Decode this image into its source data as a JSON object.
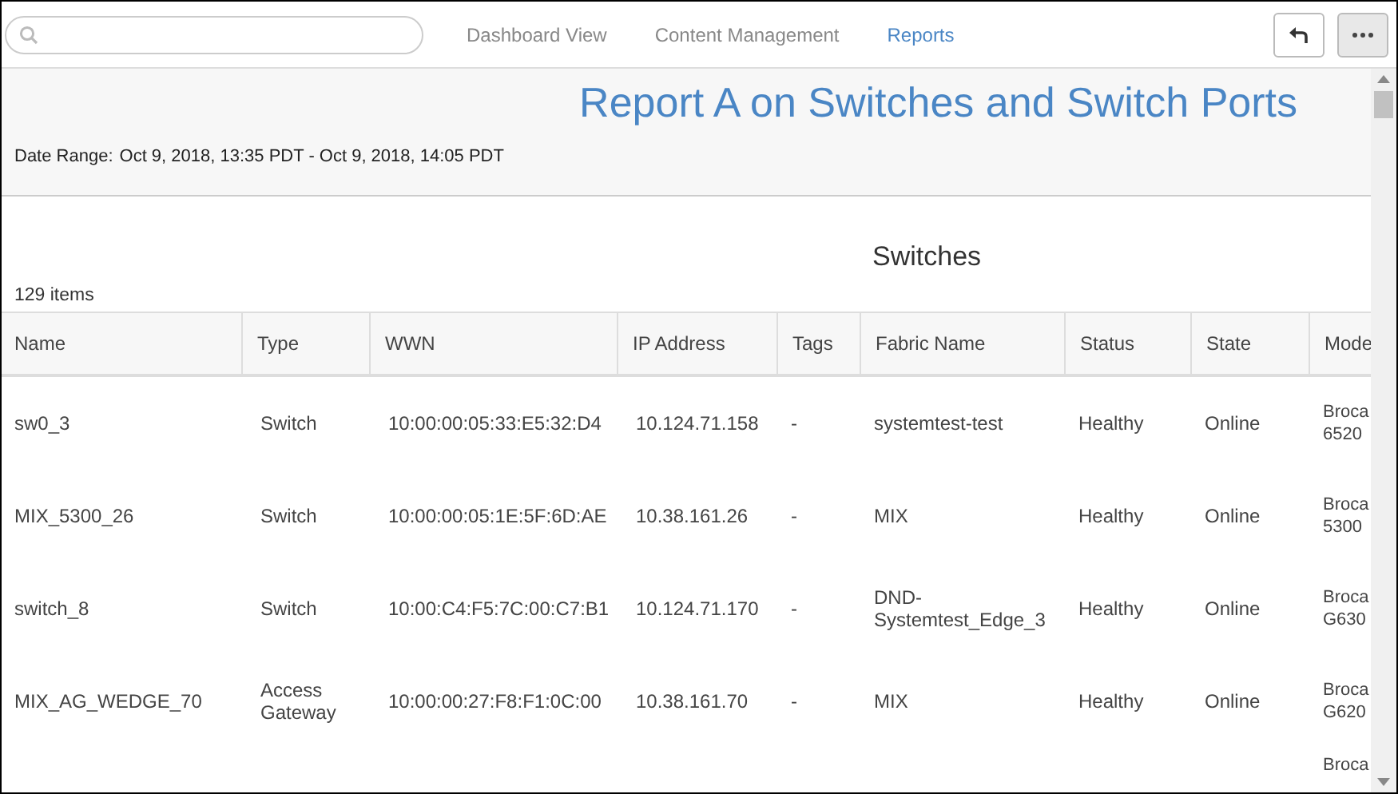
{
  "nav": [
    {
      "label": "Dashboard View",
      "selected": false
    },
    {
      "label": "Content Management",
      "selected": false
    },
    {
      "label": "Reports",
      "selected": true
    }
  ],
  "report": {
    "title": "Report A on Switches and Switch Ports",
    "date_range_label": "Date Range:",
    "date_range": "Oct 9, 2018, 13:35 PDT - Oct 9, 2018, 14:05 PDT"
  },
  "table": {
    "title": "Switches",
    "count": "129 items",
    "columns": [
      "Name",
      "Type",
      "WWN",
      "IP Address",
      "Tags",
      "Fabric Name",
      "Status",
      "State",
      "Mode"
    ],
    "rows": [
      {
        "cells": [
          [
            "sw0_3"
          ],
          [
            "Switch"
          ],
          [
            "10:00:00:05:33:E5:32:D4"
          ],
          [
            "10.124.71.158"
          ],
          [
            "-"
          ],
          [
            "systemtest-test"
          ],
          [
            "Healthy"
          ],
          [
            "Online"
          ],
          [
            "Broca",
            "6520"
          ]
        ]
      },
      {
        "cells": [
          [
            "MIX_5300_26"
          ],
          [
            "Switch"
          ],
          [
            "10:00:00:05:1E:5F:6D:AE"
          ],
          [
            "10.38.161.26"
          ],
          [
            "-"
          ],
          [
            "MIX"
          ],
          [
            "Healthy"
          ],
          [
            "Online"
          ],
          [
            "Broca",
            "5300"
          ]
        ]
      },
      {
        "cells": [
          [
            "switch_8"
          ],
          [
            "Switch"
          ],
          [
            "10:00:C4:F5:7C:00:C7:B1"
          ],
          [
            "10.124.71.170"
          ],
          [
            "-"
          ],
          [
            "DND-",
            "Systemtest_Edge_3"
          ],
          [
            "Healthy"
          ],
          [
            "Online"
          ],
          [
            "Broca",
            "G630"
          ]
        ]
      },
      {
        "cells": [
          [
            "MIX_AG_WEDGE_70"
          ],
          [
            "Access",
            "Gateway"
          ],
          [
            "10:00:00:27:F8:F1:0C:00"
          ],
          [
            "10.38.161.70"
          ],
          [
            "-"
          ],
          [
            "MIX"
          ],
          [
            "Healthy"
          ],
          [
            "Online"
          ],
          [
            "Broca",
            "G620"
          ]
        ]
      },
      {
        "cells": [
          [],
          [],
          [],
          [],
          [],
          [],
          [],
          [],
          [
            "Broca"
          ]
        ]
      }
    ]
  }
}
